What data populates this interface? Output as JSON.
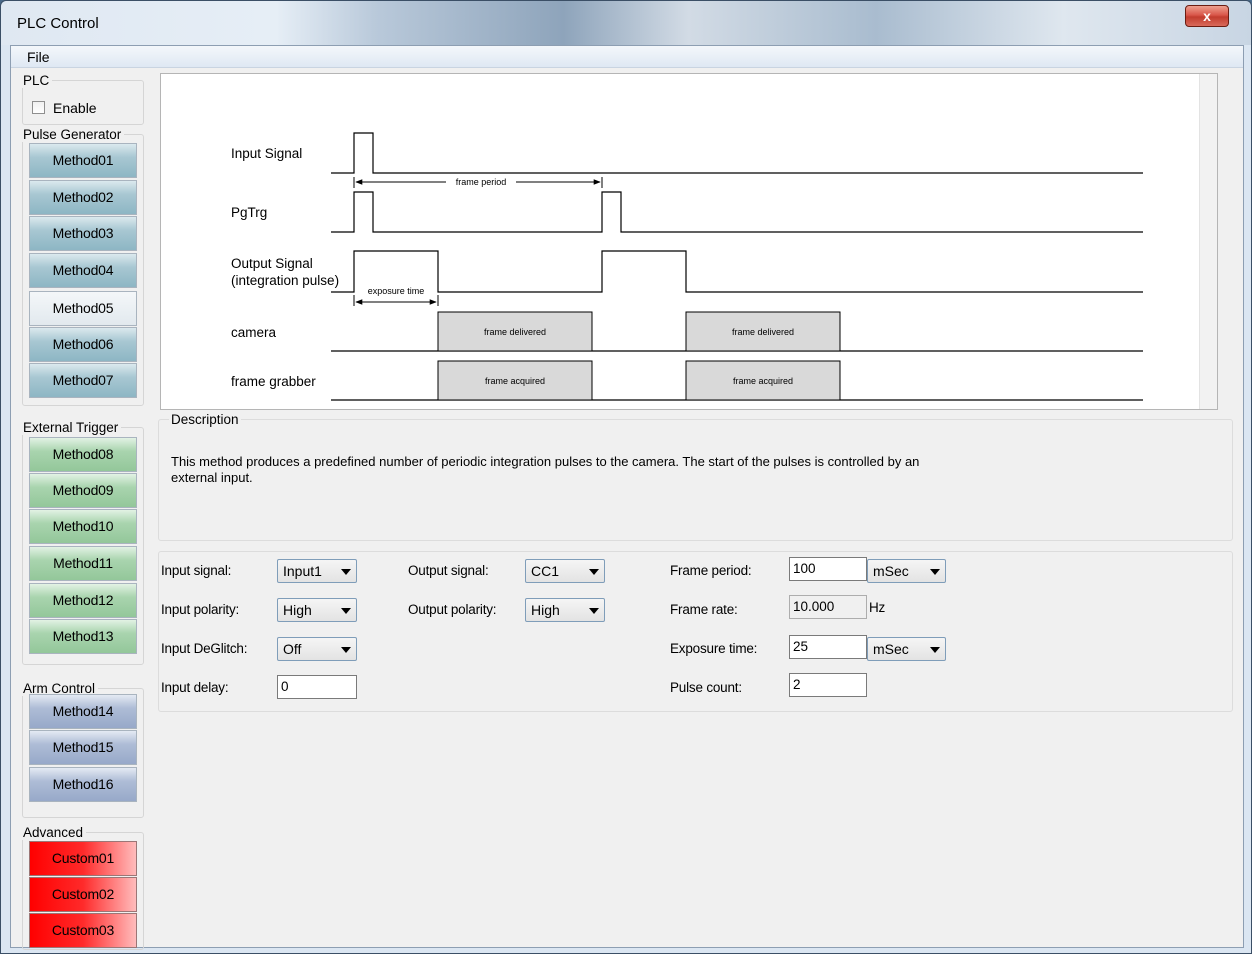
{
  "window": {
    "title": "PLC Control",
    "close_glyph": "x"
  },
  "menu": {
    "file": "File"
  },
  "plc_group": {
    "label": "PLC",
    "enable_label": "Enable",
    "enable_checked": false
  },
  "pulse_generator": {
    "label": "Pulse Generator",
    "buttons": [
      "Method01",
      "Method02",
      "Method03",
      "Method04",
      "Method05",
      "Method06",
      "Method07"
    ],
    "selected": "Method05"
  },
  "external_trigger": {
    "label": "External Trigger",
    "buttons": [
      "Method08",
      "Method09",
      "Method10",
      "Method11",
      "Method12",
      "Method13"
    ]
  },
  "arm_control": {
    "label": "Arm Control",
    "buttons": [
      "Method14",
      "Method15",
      "Method16"
    ]
  },
  "advanced": {
    "label": "Advanced",
    "buttons": [
      "Custom01",
      "Custom02",
      "Custom03"
    ]
  },
  "diagram": {
    "signals": {
      "input_signal": "Input Signal",
      "pgtrg": "PgTrg",
      "output_signal_1": "Output Signal",
      "output_signal_2": "(integration pulse)",
      "camera": "camera",
      "frame_grabber": "frame grabber"
    },
    "annotations": {
      "frame_period": "frame period",
      "exposure_time": "exposure time",
      "frame_delivered": "frame delivered",
      "frame_acquired": "frame acquired"
    }
  },
  "description": {
    "label": "Description",
    "text": "This method produces a predefined number of periodic integration pulses to the camera. The start of the pulses is controlled by an external input."
  },
  "params": {
    "input_signal": {
      "label": "Input signal:",
      "value": "Input1"
    },
    "input_polarity": {
      "label": "Input polarity:",
      "value": "High"
    },
    "input_deglitch": {
      "label": "Input DeGlitch:",
      "value": "Off"
    },
    "input_delay": {
      "label": "Input delay:",
      "value": "0"
    },
    "output_signal": {
      "label": "Output signal:",
      "value": "CC1"
    },
    "output_polarity": {
      "label": "Output polarity:",
      "value": "High"
    },
    "frame_period": {
      "label": "Frame period:",
      "value": "100",
      "unit": "mSec"
    },
    "frame_rate": {
      "label": "Frame rate:",
      "value": "10.000",
      "unit": "Hz"
    },
    "exposure_time": {
      "label": "Exposure time:",
      "value": "25",
      "unit": "mSec"
    },
    "pulse_count": {
      "label": "Pulse count:",
      "value": "2"
    }
  }
}
